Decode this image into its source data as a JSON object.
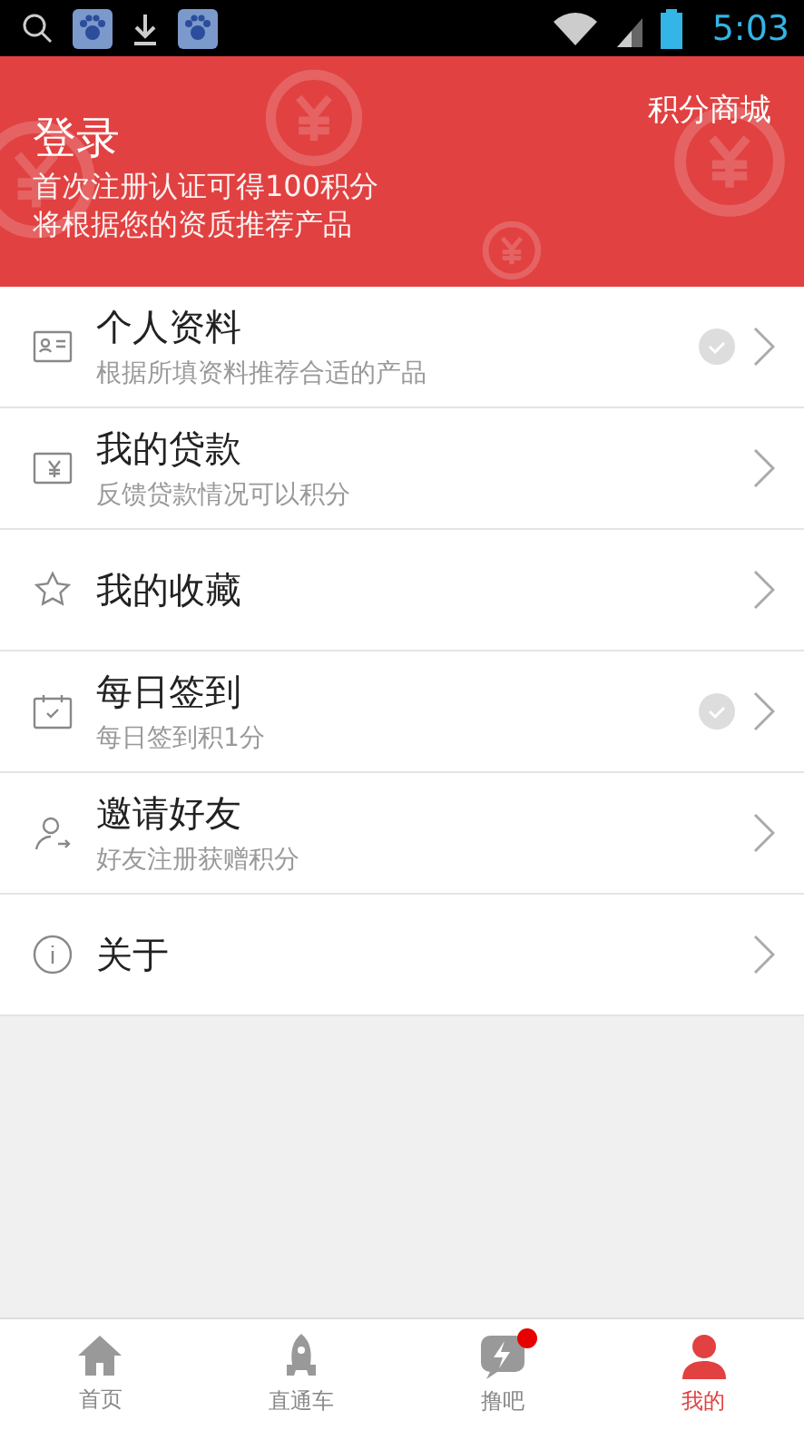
{
  "status_bar": {
    "time": "5:03"
  },
  "header": {
    "title": "登录",
    "lines": [
      "首次注册认证可得100积分",
      "将根据您的资质推荐产品"
    ],
    "action": "积分商城"
  },
  "menu": [
    {
      "title": "个人资料",
      "subtitle": "根据所填资料推荐合适的产品",
      "checked": true
    },
    {
      "title": "我的贷款",
      "subtitle": "反馈贷款情况可以积分",
      "checked": false
    },
    {
      "title": "我的收藏",
      "checked": false
    },
    {
      "title": "每日签到",
      "subtitle": "每日签到积1分",
      "checked": true
    },
    {
      "title": "邀请好友",
      "subtitle": "好友注册获赠积分",
      "checked": false
    },
    {
      "title": "关于",
      "checked": false
    }
  ],
  "tabs": [
    {
      "label": "首页",
      "selected": false,
      "badge": false
    },
    {
      "label": "直通车",
      "selected": false,
      "badge": false
    },
    {
      "label": "撸吧",
      "selected": false,
      "badge": true
    },
    {
      "label": "我的",
      "selected": true,
      "badge": false
    }
  ]
}
